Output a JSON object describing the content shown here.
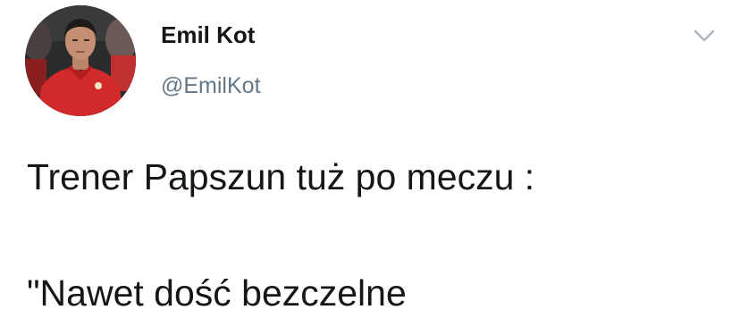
{
  "tweet": {
    "author": {
      "display_name": "Emil Kot",
      "handle": "@EmilKot",
      "avatar": "profile-photo-red-polo"
    },
    "menu_icon": "chevron-down-icon",
    "text_lines": [
      "Trener Papszun tuż po meczu :",
      "\"Nawet dość bezczelne"
    ]
  },
  "colors": {
    "background": "#ffffff",
    "text": "#14171a",
    "secondary": "#657786",
    "chevron": "#aab8c2"
  }
}
